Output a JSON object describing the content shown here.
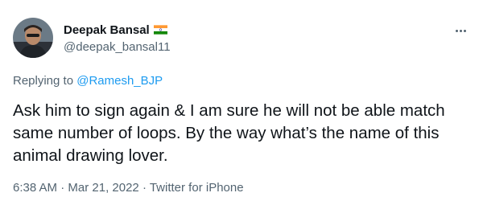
{
  "tweet": {
    "display_name": "Deepak Bansal",
    "flag_icon": "india-flag-icon",
    "handle": "@deepak_bansal11",
    "replying_prefix": "Replying to ",
    "replying_to": "@Ramesh_BJP",
    "text": "Ask him to sign again & I am sure he will not be able match same number of loops. By the way what’s the name of this animal drawing lover.",
    "time": "6:38 AM",
    "separator": " · ",
    "date": "Mar 21, 2022",
    "source": "Twitter for iPhone",
    "more_icon": "more-options-icon"
  },
  "colors": {
    "text_primary": "#0f1419",
    "text_secondary": "#536471",
    "link": "#1d9bf0"
  }
}
